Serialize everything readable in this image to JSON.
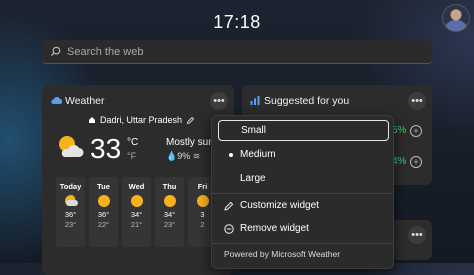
{
  "header": {
    "time": "17:18"
  },
  "search": {
    "placeholder": "Search the web"
  },
  "weather": {
    "title": "Weather",
    "location": "Dadri, Uttar Pradesh",
    "temperature": "33",
    "unit_celsius": "°C",
    "unit_fahrenheit": "°F",
    "condition": "Mostly sun",
    "precipitation": "9%",
    "forecast": [
      {
        "day": "Today",
        "icon": "partly-cloudy-icon",
        "high": "36°",
        "low": "23°"
      },
      {
        "day": "Tue",
        "icon": "sunny-icon",
        "high": "36°",
        "low": "22°"
      },
      {
        "day": "Wed",
        "icon": "sunny-icon",
        "high": "34°",
        "low": "21°"
      },
      {
        "day": "Thu",
        "icon": "sunny-icon",
        "high": "34°",
        "low": "23°"
      },
      {
        "day": "Fri",
        "icon": "sunny-icon",
        "high": "3",
        "low": "2"
      }
    ]
  },
  "suggested": {
    "title": "Suggested for you",
    "items": [
      {
        "change": "5%"
      },
      {
        "change": "4%"
      }
    ]
  },
  "context_menu": {
    "sizes": [
      {
        "label": "Small",
        "selected": true
      },
      {
        "label": "Medium",
        "current": true
      },
      {
        "label": "Large"
      }
    ],
    "customize": "Customize widget",
    "remove": "Remove widget",
    "footer": "Powered by Microsoft Weather"
  },
  "colors": {
    "accent_green": "#3fd270",
    "sun": "#f5b21a"
  }
}
